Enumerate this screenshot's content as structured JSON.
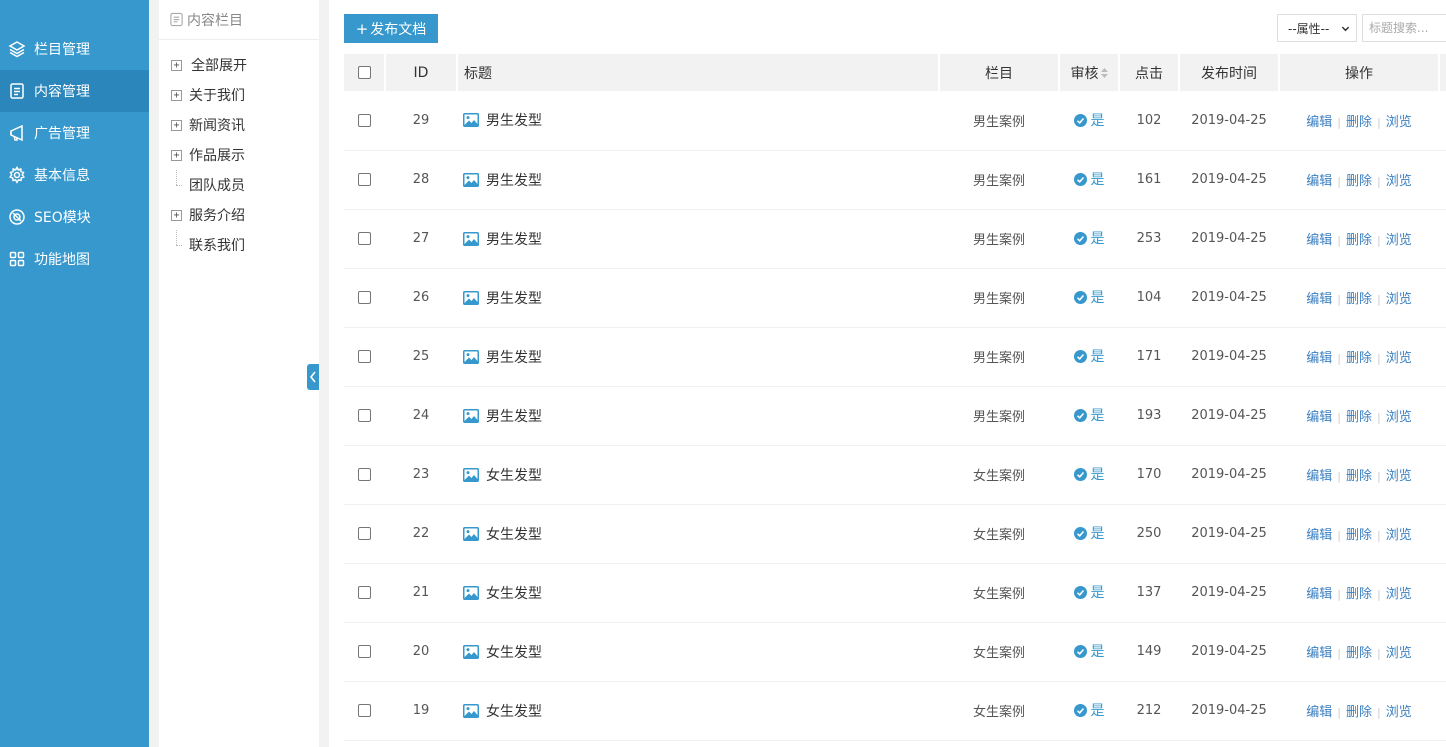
{
  "nav": {
    "items": [
      {
        "label": "栏目管理",
        "icon": "layers-icon"
      },
      {
        "label": "内容管理",
        "icon": "document-icon"
      },
      {
        "label": "广告管理",
        "icon": "ad-icon"
      },
      {
        "label": "基本信息",
        "icon": "gear-icon"
      },
      {
        "label": "SEO模块",
        "icon": "seo-icon"
      },
      {
        "label": "功能地图",
        "icon": "grid-icon"
      }
    ],
    "active_index": 1
  },
  "tree": {
    "header": "内容栏目",
    "expand_all": "全部展开",
    "nodes": [
      {
        "label": "关于我们",
        "type": "folder"
      },
      {
        "label": "新闻资讯",
        "type": "folder"
      },
      {
        "label": "作品展示",
        "type": "folder"
      },
      {
        "label": "团队成员",
        "type": "leaf"
      },
      {
        "label": "服务介绍",
        "type": "folder"
      },
      {
        "label": "联系我们",
        "type": "leaf-last"
      }
    ]
  },
  "toolbar": {
    "publish_label": "发布文档",
    "attr_select_value": "--属性--",
    "search_placeholder": "标题搜索..."
  },
  "table": {
    "headers": {
      "id": "ID",
      "title": "标题",
      "column": "栏目",
      "audit": "审核",
      "clicks": "点击",
      "date": "发布时间",
      "ops": "操作"
    },
    "ops_labels": {
      "edit": "编辑",
      "delete": "删除",
      "view": "浏览"
    },
    "rows": [
      {
        "id": "29",
        "title": "男生发型",
        "column": "男生案例",
        "audit": "是",
        "clicks": "102",
        "date": "2019-04-25"
      },
      {
        "id": "28",
        "title": "男生发型",
        "column": "男生案例",
        "audit": "是",
        "clicks": "161",
        "date": "2019-04-25"
      },
      {
        "id": "27",
        "title": "男生发型",
        "column": "男生案例",
        "audit": "是",
        "clicks": "253",
        "date": "2019-04-25"
      },
      {
        "id": "26",
        "title": "男生发型",
        "column": "男生案例",
        "audit": "是",
        "clicks": "104",
        "date": "2019-04-25"
      },
      {
        "id": "25",
        "title": "男生发型",
        "column": "男生案例",
        "audit": "是",
        "clicks": "171",
        "date": "2019-04-25"
      },
      {
        "id": "24",
        "title": "男生发型",
        "column": "男生案例",
        "audit": "是",
        "clicks": "193",
        "date": "2019-04-25"
      },
      {
        "id": "23",
        "title": "女生发型",
        "column": "女生案例",
        "audit": "是",
        "clicks": "170",
        "date": "2019-04-25"
      },
      {
        "id": "22",
        "title": "女生发型",
        "column": "女生案例",
        "audit": "是",
        "clicks": "250",
        "date": "2019-04-25"
      },
      {
        "id": "21",
        "title": "女生发型",
        "column": "女生案例",
        "audit": "是",
        "clicks": "137",
        "date": "2019-04-25"
      },
      {
        "id": "20",
        "title": "女生发型",
        "column": "女生案例",
        "audit": "是",
        "clicks": "149",
        "date": "2019-04-25"
      },
      {
        "id": "19",
        "title": "女生发型",
        "column": "女生案例",
        "audit": "是",
        "clicks": "212",
        "date": "2019-04-25"
      }
    ]
  },
  "colors": {
    "brand": "#3698cc",
    "brand_active": "#2b86bb",
    "link": "#3a7fc0"
  }
}
